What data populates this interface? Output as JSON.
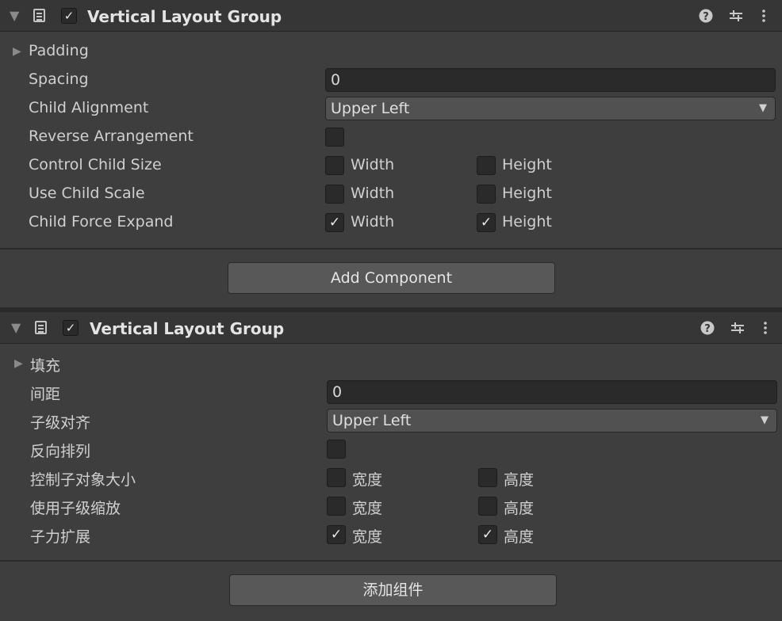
{
  "components": [
    {
      "title": "Vertical Layout Group",
      "enabled_check": "✓",
      "padding_label": "Padding",
      "fields": {
        "spacing": {
          "label": "Spacing",
          "value": "0"
        },
        "child_alignment": {
          "label": "Child Alignment",
          "value": "Upper Left"
        },
        "reverse_arrangement": {
          "label": "Reverse Arrangement",
          "checked": false
        },
        "control_child_size": {
          "label": "Control Child Size",
          "width_label": "Width",
          "height_label": "Height",
          "width": false,
          "height": false
        },
        "use_child_scale": {
          "label": "Use Child Scale",
          "width_label": "Width",
          "height_label": "Height",
          "width": false,
          "height": false
        },
        "child_force_expand": {
          "label": "Child Force Expand",
          "width_label": "Width",
          "height_label": "Height",
          "width": true,
          "height": true,
          "width_check": "✓",
          "height_check": "✓"
        }
      },
      "add_component_label": "Add Component"
    },
    {
      "title": "Vertical Layout Group",
      "enabled_check": "✓",
      "padding_label": "填充",
      "fields": {
        "spacing": {
          "label": "间距",
          "value": "0"
        },
        "child_alignment": {
          "label": "子级对齐",
          "value": "Upper Left"
        },
        "reverse_arrangement": {
          "label": "反向排列",
          "checked": false
        },
        "control_child_size": {
          "label": "控制子对象大小",
          "width_label": "宽度",
          "height_label": "高度",
          "width": false,
          "height": false
        },
        "use_child_scale": {
          "label": "使用子级缩放",
          "width_label": "宽度",
          "height_label": "高度",
          "width": false,
          "height": false
        },
        "child_force_expand": {
          "label": "子力扩展",
          "width_label": "宽度",
          "height_label": "高度",
          "width": true,
          "height": true,
          "width_check": "✓",
          "height_check": "✓"
        }
      },
      "add_component_label": "添加组件"
    }
  ],
  "icons": {
    "fold": "foldout-triangle-icon",
    "script": "script-book-icon",
    "help": "help-icon",
    "presets": "presets-sliders-icon",
    "menu": "kebab-menu-icon"
  },
  "colors": {
    "background": "#3e3e3e",
    "header": "#363636",
    "field": "#2a2a2a",
    "button": "#585858",
    "text": "#d0d0d0"
  }
}
